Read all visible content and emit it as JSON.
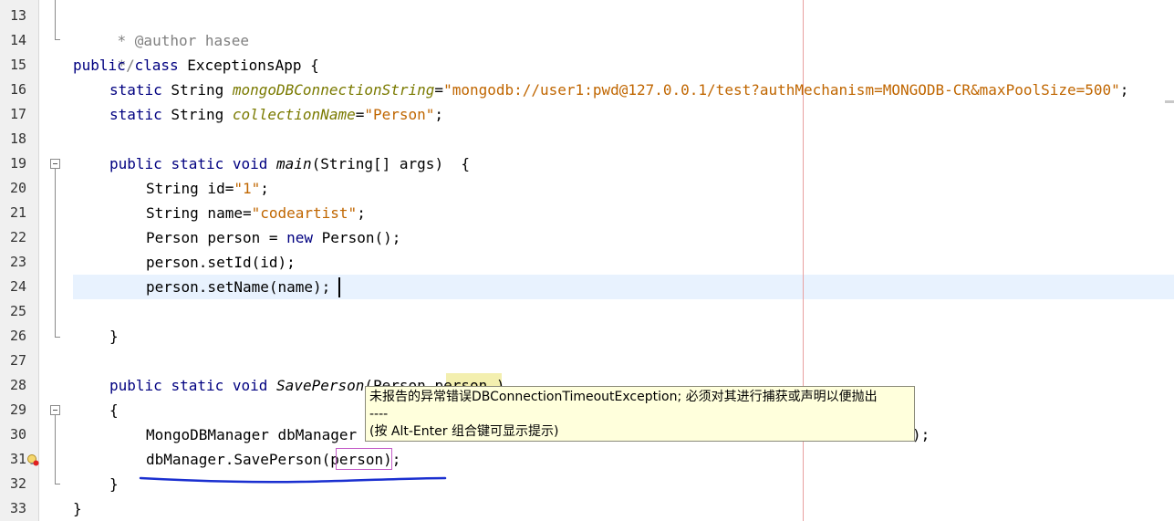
{
  "gutter": {
    "line_numbers": [
      "13",
      "14",
      "15",
      "16",
      "17",
      "18",
      "19",
      "20",
      "21",
      "22",
      "23",
      "24",
      "25",
      "26",
      "27",
      "28",
      "29",
      "30",
      "31",
      "32",
      "33"
    ]
  },
  "code": {
    "l13": {
      "comment": "* @author hasee"
    },
    "l14": {
      "comment": "*/"
    },
    "l15": {
      "kw1": "public",
      "kw2": "class",
      "rest": " ExceptionsApp {"
    },
    "l16": {
      "kw": "static",
      "type": " String ",
      "field": "mongoDBConnectionString",
      "eq": "=",
      "str": "\"mongodb://user1:pwd@127.0.0.1/test?authMechanism=MONGODB-CR&maxPoolSize=500\"",
      "end": ";"
    },
    "l17": {
      "kw": "static",
      "type": " String ",
      "field": "collectionName",
      "eq": "=",
      "str": "\"Person\"",
      "end": ";"
    },
    "l19": {
      "kw1": "public",
      "kw2": "static",
      "kw3": "void",
      "method": "main",
      "rest": "(String[] args)  {"
    },
    "l20": {
      "pre": "String id=",
      "str": "\"1\"",
      "end": ";"
    },
    "l21": {
      "pre": "String name=",
      "str": "\"codeartist\"",
      "end": ";"
    },
    "l22": {
      "pre": "Person person = ",
      "kw": "new",
      "end": " Person();"
    },
    "l23": {
      "text": "person.setId(id);"
    },
    "l24": {
      "text": "person.setName(name);"
    },
    "l26": {
      "text": "}"
    },
    "l28": {
      "kw1": "public",
      "kw2": "static",
      "kw3": "void",
      "method": "SavePerson",
      "rest": "(Person person )"
    },
    "l29": {
      "text": "{"
    },
    "l30": {
      "text": "MongoDBManager dbManager",
      "tail": ");"
    },
    "l31": {
      "text": "dbManager.SavePerson(person);"
    },
    "l32": {
      "text": "}"
    },
    "l33": {
      "text": "}"
    }
  },
  "tooltip": {
    "line1": "未报告的异常错误DBConnectionTimeoutException; 必须对其进行捕获或声明以便抛出",
    "line2": "----",
    "line3": "(按 Alt-Enter 组合键可显示提示)"
  },
  "icons": {
    "warning": "error-lightbulb-icon"
  },
  "colors": {
    "keyword": "#000080",
    "field": "#7a7a00",
    "string": "#c06600",
    "comment": "#808080",
    "tooltip_bg": "#ffffdc",
    "ink": "#1a2fd0"
  }
}
